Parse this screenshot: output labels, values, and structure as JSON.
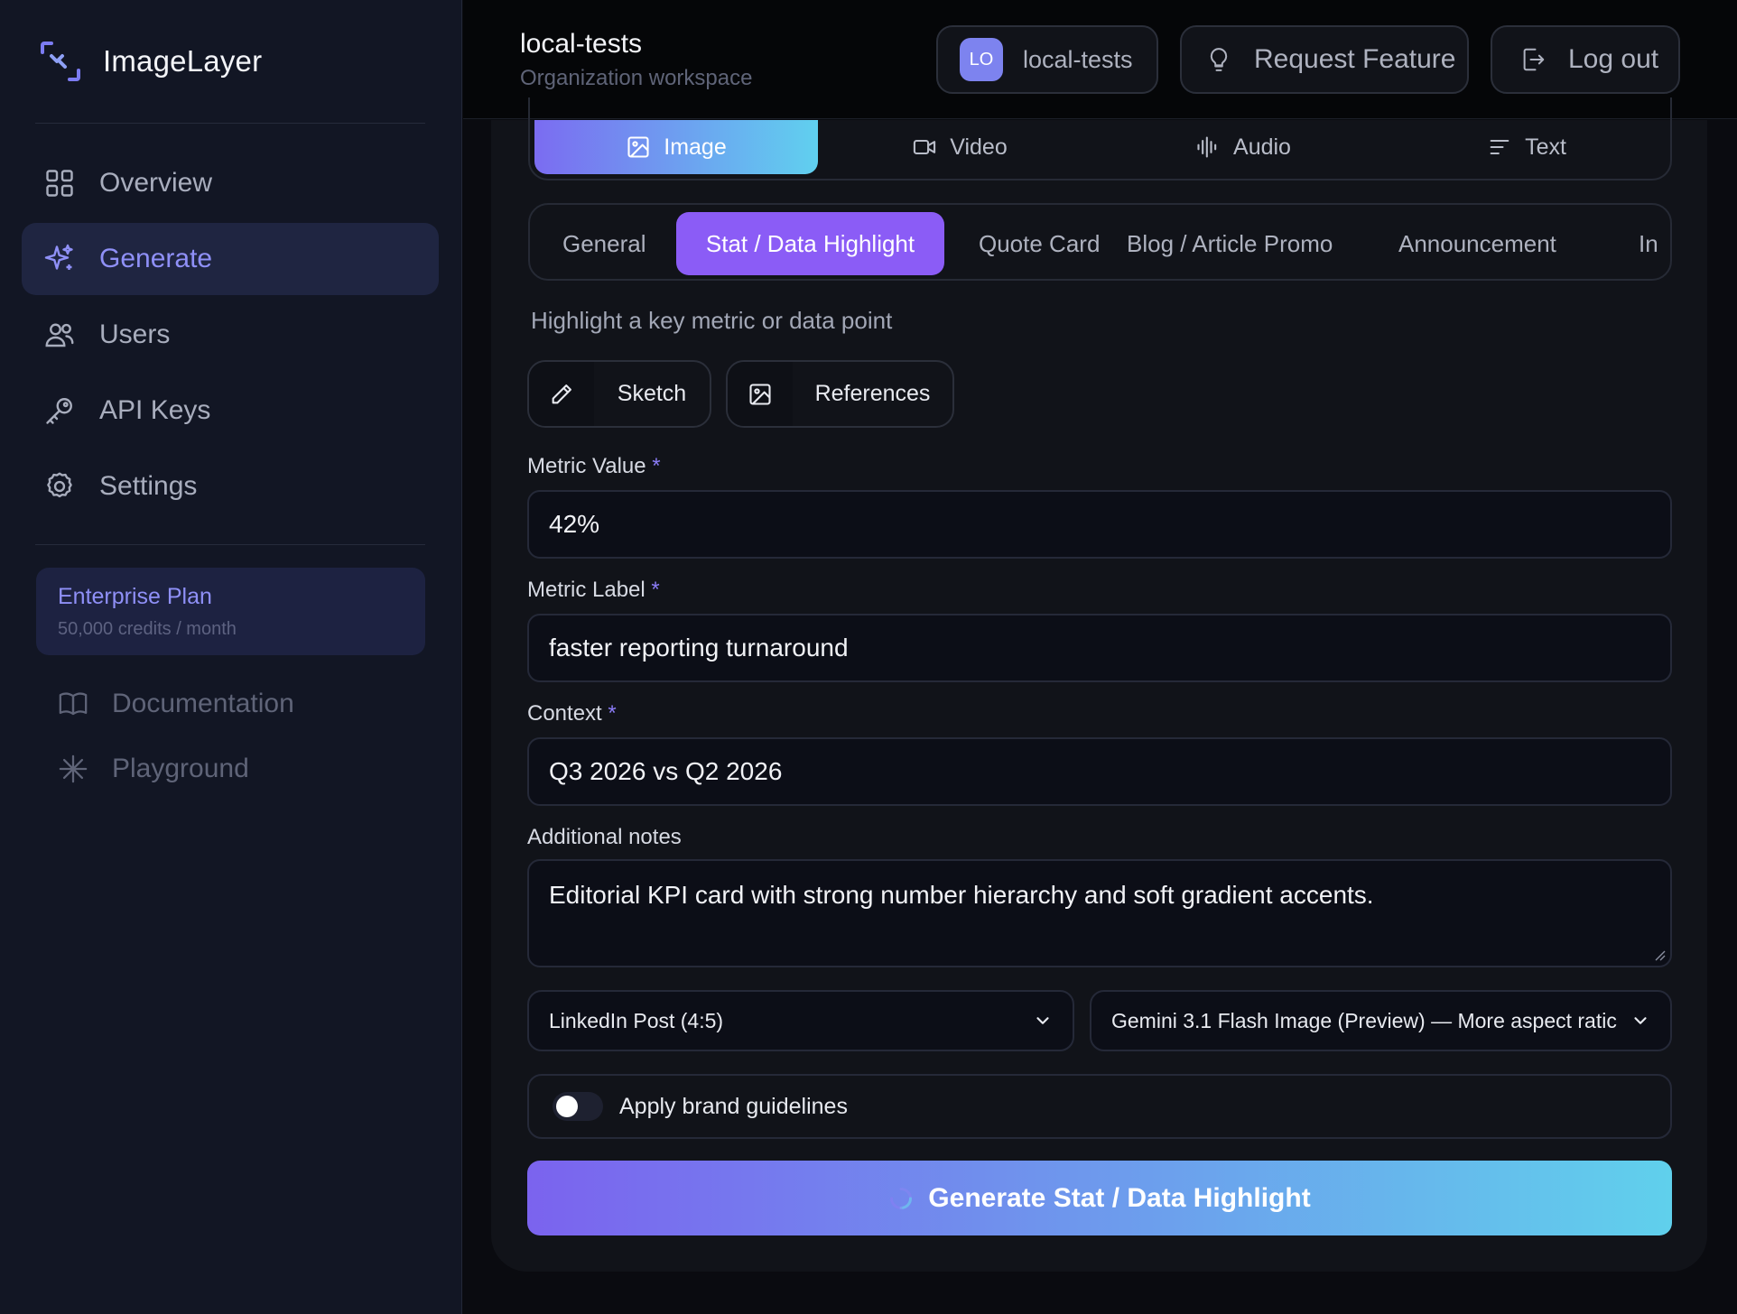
{
  "brand": {
    "name": "ImageLayer"
  },
  "sidebar": {
    "nav": [
      {
        "label": "Overview",
        "icon": "grid-icon"
      },
      {
        "label": "Generate",
        "icon": "sparkle-icon",
        "active": true
      },
      {
        "label": "Users",
        "icon": "users-icon"
      },
      {
        "label": "API Keys",
        "icon": "key-icon"
      },
      {
        "label": "Settings",
        "icon": "gear-icon"
      }
    ],
    "plan": {
      "name": "Enterprise Plan",
      "credits": "50,000 credits / month"
    },
    "links": [
      {
        "label": "Documentation",
        "icon": "book-icon"
      },
      {
        "label": "Playground",
        "icon": "asterisk-icon"
      }
    ]
  },
  "header": {
    "title": "local-tests",
    "subtitle": "Organization workspace",
    "org": {
      "avatar": "LO",
      "label": "local-tests"
    },
    "request_feature": "Request Feature",
    "logout": "Log out"
  },
  "media_tabs": [
    {
      "label": "Image",
      "icon": "image-icon",
      "active": true
    },
    {
      "label": "Video",
      "icon": "video-icon"
    },
    {
      "label": "Audio",
      "icon": "audio-icon"
    },
    {
      "label": "Text",
      "icon": "text-icon"
    }
  ],
  "template_tabs": [
    {
      "label": "General"
    },
    {
      "label": "Stat / Data Highlight",
      "active": true
    },
    {
      "label": "Quote Card"
    },
    {
      "label": "Blog / Article Promo"
    },
    {
      "label": "Announcement"
    },
    {
      "label": "In"
    }
  ],
  "template_description": "Highlight a key metric or data point",
  "tools": {
    "sketch": "Sketch",
    "references": "References"
  },
  "form": {
    "metric_value": {
      "label": "Metric Value",
      "required": "*",
      "value": "42%"
    },
    "metric_label": {
      "label": "Metric Label",
      "required": "*",
      "value": "faster reporting turnaround"
    },
    "context": {
      "label": "Context",
      "required": "*",
      "value": "Q3 2026 vs Q2 2026"
    },
    "notes": {
      "label": "Additional notes",
      "value": "Editorial KPI card with strong number hierarchy and soft gradient accents."
    },
    "format": "LinkedIn Post (4:5)",
    "model": "Gemini 3.1 Flash Image (Preview) — More aspect ratic",
    "brand_toggle": {
      "label": "Apply brand guidelines",
      "on": false
    }
  },
  "generate_button": "Generate Stat / Data Highlight",
  "colors": {
    "accent": "#8b5cf6",
    "gradient_start": "#7b63ee",
    "gradient_end": "#60d0ec",
    "sidebar_bg": "#121624",
    "active_nav": "#8f90f7"
  }
}
